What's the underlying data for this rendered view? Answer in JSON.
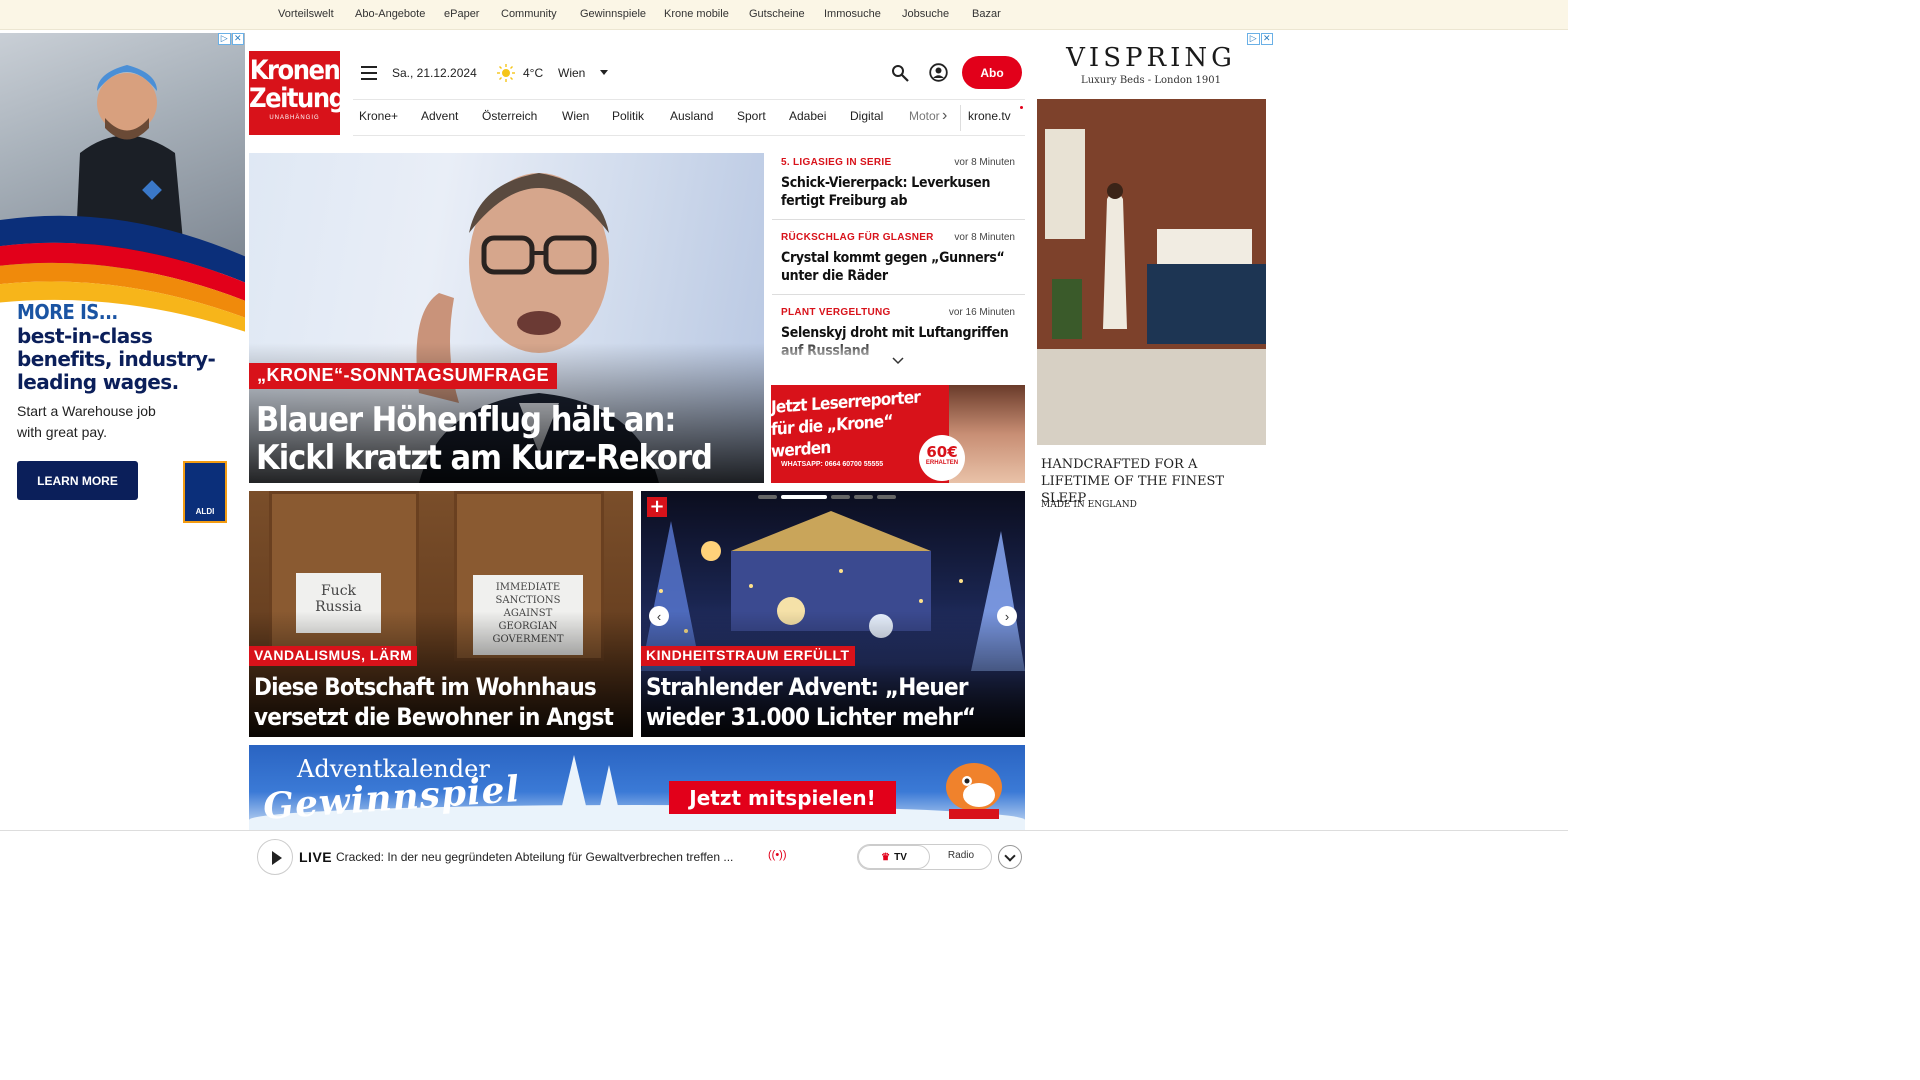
{
  "topbar": {
    "links": [
      "Vorteilswelt",
      "Abo-Angebote",
      "ePaper",
      "Community",
      "Gewinnspiele",
      "Krone mobile",
      "Gutscheine",
      "Immosuche",
      "Jobsuche",
      "Bazar"
    ]
  },
  "ad_left": {
    "more_is": "MORE IS...",
    "headline": "best-in-class benefits, industry-leading wages.",
    "sub": "Start a Warehouse job with great pay.",
    "button": "LEARN MORE",
    "logo": "ALDI"
  },
  "header": {
    "logo_line1": "Kronen",
    "logo_line2": "Zeitung",
    "logo_small": "UNABHÄNGIG",
    "date": "Sa., 21.12.2024",
    "temperature": "4°C",
    "city": "Wien",
    "abo": "Abo"
  },
  "nav": {
    "items": [
      "Krone+",
      "Advent",
      "Österreich",
      "Wien",
      "Politik",
      "Ausland",
      "Sport",
      "Adabei",
      "Digital",
      "Motor"
    ],
    "tv": "krone.tv"
  },
  "hero": {
    "kicker": "„KRONE“-SONNTAGSUMFRAGE",
    "title": "Blauer Höhenflug hält an: Kickl kratzt am Kurz-Rekord"
  },
  "news": [
    {
      "kicker": "5. LIGASIEG IN SERIE",
      "time": "vor 8 Minuten",
      "title": "Schick-Viererpack: Leverkusen fertigt Freiburg ab"
    },
    {
      "kicker": "RÜCKSCHLAG FÜR GLASNER",
      "time": "vor 8 Minuten",
      "title": "Crystal kommt gegen „Gunners“ unter die Räder"
    },
    {
      "kicker": "PLANT VERGELTUNG",
      "time": "vor 16 Minuten",
      "title": "Selenskyj droht mit Luftangriffen auf Russland"
    }
  ],
  "reporter": {
    "headline": "Jetzt Leserreporter für die „Krone“ werden",
    "whatsapp": "WHATSAPP: 0664 60700 55555",
    "amount": "60€",
    "amount_sub": "ERHALTEN"
  },
  "teasers": [
    {
      "kicker": "VANDALISMUS, LÄRM",
      "title": "Diese Botschaft im Wohnhaus versetzt die Bewohner in Angst",
      "sign1": "Fuck Russia",
      "sign2": "IMMEDIATE SANCTIONS AGAINST GEORGIAN GOVERMENT"
    },
    {
      "kicker": "KINDHEITSTRAUM ERFÜLLT",
      "title": "Strahlender Advent: „Heuer wieder 31.000 Lichter mehr“"
    }
  ],
  "advent": {
    "line1": "Adventkalender",
    "line2": "Gewinnspiel",
    "cta": "Jetzt mitspielen!"
  },
  "ad_right": {
    "brand": "VISPRING",
    "tagline": "Luxury Beds - London 1901",
    "copy": "HANDCRAFTED FOR A LIFETIME OF THE FINEST SLEEP",
    "made": "MADE IN ENGLAND"
  },
  "live": {
    "label": "LIVE",
    "text": "Cracked: In der neu gegründeten Abteilung für Gewaltverbrechen treffen ...",
    "tv": "TV",
    "radio": "Radio"
  },
  "colors": {
    "brand_red": "#d8121a",
    "topbar_bg": "#fbf6e6",
    "ad_navy": "#0b1f5a"
  }
}
